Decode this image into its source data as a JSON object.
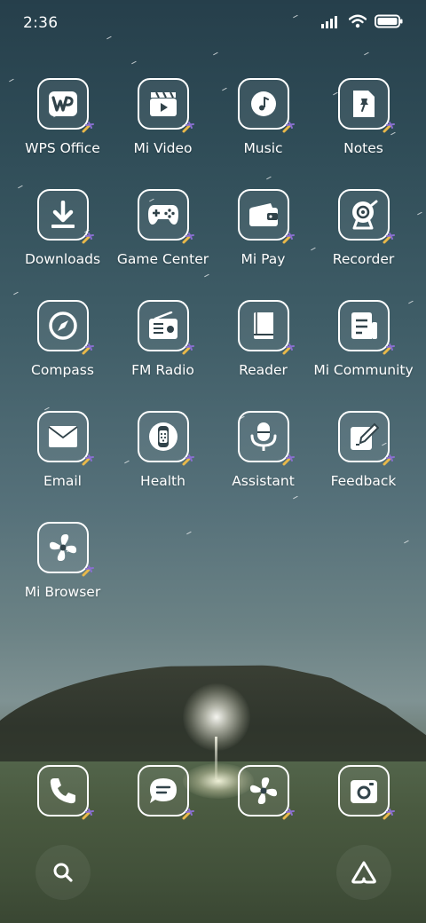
{
  "status_bar": {
    "time": "2:36",
    "icons": [
      "signal-icon",
      "wifi-icon",
      "battery-icon"
    ]
  },
  "apps": [
    {
      "name": "WPS Office",
      "icon": "wps-icon"
    },
    {
      "name": "Mi Video",
      "icon": "video-clapper-icon"
    },
    {
      "name": "Music",
      "icon": "music-note-icon"
    },
    {
      "name": "Notes",
      "icon": "note-pin-icon"
    },
    {
      "name": "Downloads",
      "icon": "download-icon"
    },
    {
      "name": "Game Center",
      "icon": "gamepad-icon"
    },
    {
      "name": "Mi Pay",
      "icon": "wallet-icon"
    },
    {
      "name": "Recorder",
      "icon": "recorder-icon"
    },
    {
      "name": "Compass",
      "icon": "compass-icon"
    },
    {
      "name": "FM Radio",
      "icon": "radio-icon"
    },
    {
      "name": "Reader",
      "icon": "book-icon"
    },
    {
      "name": "Mi Community",
      "icon": "community-icon"
    },
    {
      "name": "Email",
      "icon": "envelope-icon"
    },
    {
      "name": "Health",
      "icon": "watch-icon"
    },
    {
      "name": "Assistant",
      "icon": "microphone-icon"
    },
    {
      "name": "Feedback",
      "icon": "edit-icon"
    },
    {
      "name": "Mi Browser",
      "icon": "browser-icon"
    }
  ],
  "dock": [
    {
      "icon": "phone-icon"
    },
    {
      "icon": "message-icon"
    },
    {
      "icon": "browser-icon"
    },
    {
      "icon": "camera-icon"
    }
  ],
  "bottom_bar": {
    "left_icon": "search-icon",
    "right_icon": "assistant-logo-icon"
  },
  "colors": {
    "icon_outline": "#ffffff",
    "badge_gold": "#e8b84a",
    "badge_purple": "#8a6fd0"
  }
}
